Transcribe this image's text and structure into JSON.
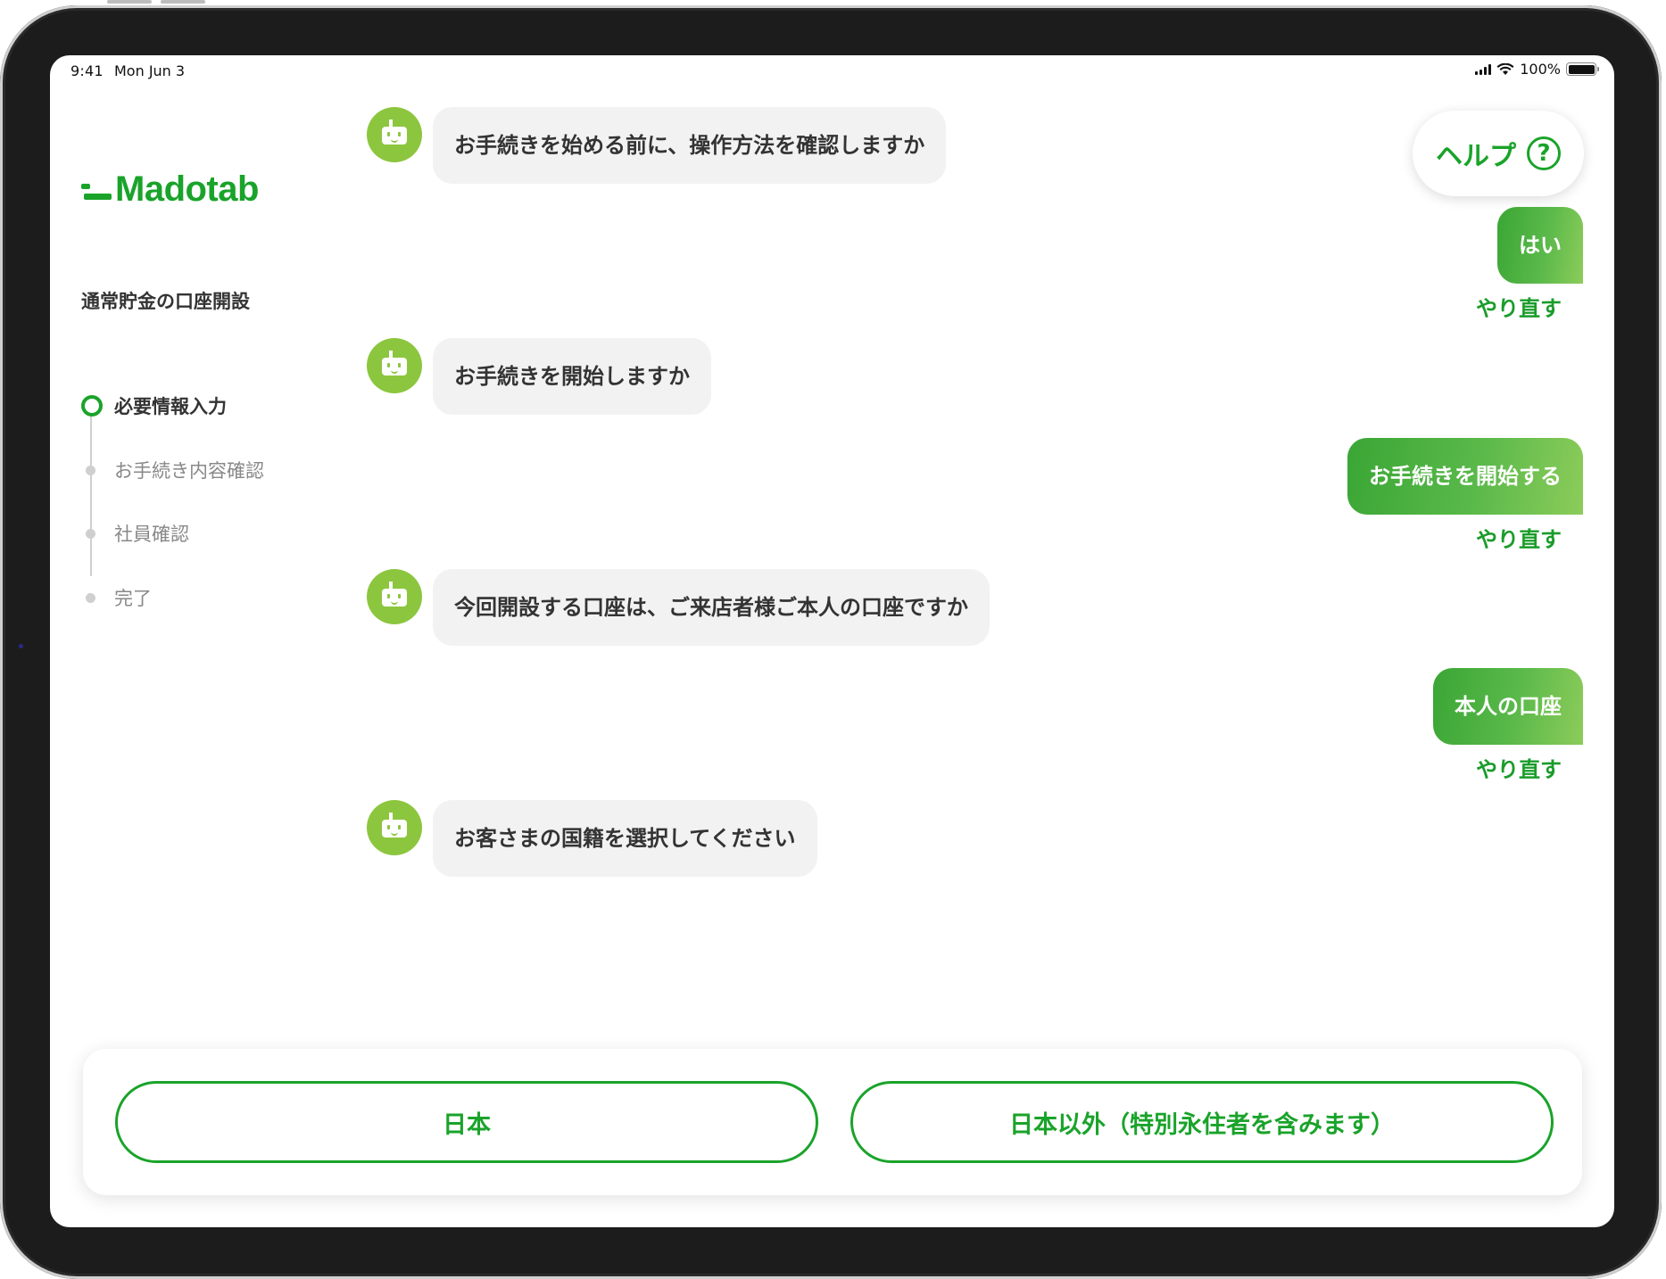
{
  "status_bar": {
    "time": "9:41",
    "date": "Mon Jun 3",
    "battery": "100%"
  },
  "sidebar": {
    "logo": "Madotab",
    "service_title": "通常貯金の口座開設",
    "steps": [
      {
        "label": "必要情報入力",
        "state": "current"
      },
      {
        "label": "お手続き内容確認",
        "state": "pending"
      },
      {
        "label": "社員確認",
        "state": "pending"
      },
      {
        "label": "完了",
        "state": "pending"
      }
    ]
  },
  "help": {
    "label": "ヘルプ",
    "icon": "question-circle-icon"
  },
  "chat": {
    "bot_messages": [
      "お手続きを始める前に、操作方法を確認しますか",
      "お手続きを開始しますか",
      "今回開設する口座は、ご来店者様ご本人の口座ですか",
      "お客さまの国籍を選択してください"
    ],
    "user_replies": [
      "はい",
      "お手続きを開始する",
      "本人の口座"
    ],
    "redo_label": "やり直す"
  },
  "answers": {
    "options": [
      "日本",
      "日本以外（特別永住者を含みます）"
    ]
  },
  "colors": {
    "accent": "#1aa32a",
    "bot_avatar": "#8cc63f",
    "bot_bubble": "#f2f2f2"
  }
}
